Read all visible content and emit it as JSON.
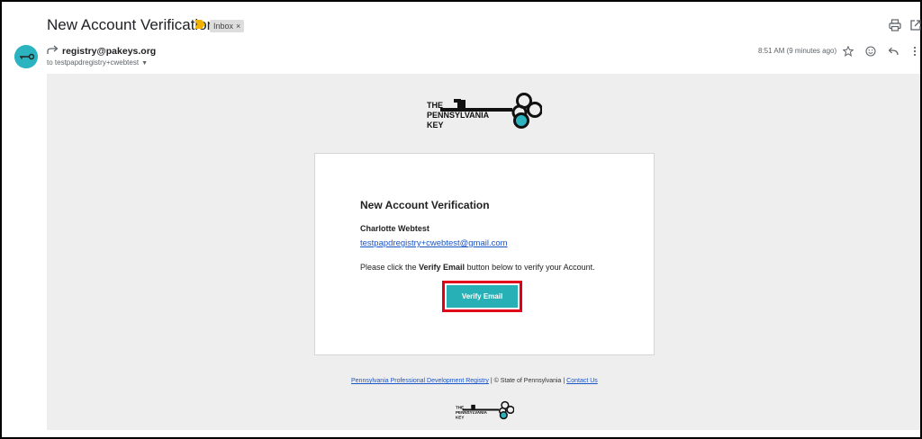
{
  "header": {
    "subject": "New Account Verification",
    "label": "Inbox",
    "label_close": "×"
  },
  "message": {
    "sender": "registry@pakeys.org",
    "recipient": "to testpapdregistry+cwebtest",
    "timestamp": "8:51 AM (9 minutes ago)"
  },
  "email": {
    "logo_lines": [
      "THE",
      "PENNSYLVANIA",
      "KEY"
    ],
    "card": {
      "title": "New Account Verification",
      "name": "Charlotte Webtest",
      "email": "testpapdregistry+cwebtest@gmail.com",
      "text_before": "Please click the ",
      "text_bold": "Verify Email",
      "text_after": " button below to verify your Account.",
      "button_label": "Verify Email"
    },
    "footer": {
      "link1": "Pennsylvania Professional Development Registry",
      "separator1": " | © State of Pennsylvania | ",
      "link2": "Contact Us"
    }
  },
  "colors": {
    "accent_teal": "#27b0b5",
    "avatar": "#2bb3bf",
    "highlight_border": "#e0001a",
    "important_marker": "#f2b200",
    "link": "#1a55c8"
  },
  "icons": [
    "important-marker-icon",
    "print-icon",
    "open-new-window-icon",
    "reply-arrow-icon",
    "star-icon",
    "emoji-icon",
    "reply-icon",
    "more-vert-icon",
    "key-logo-icon"
  ]
}
